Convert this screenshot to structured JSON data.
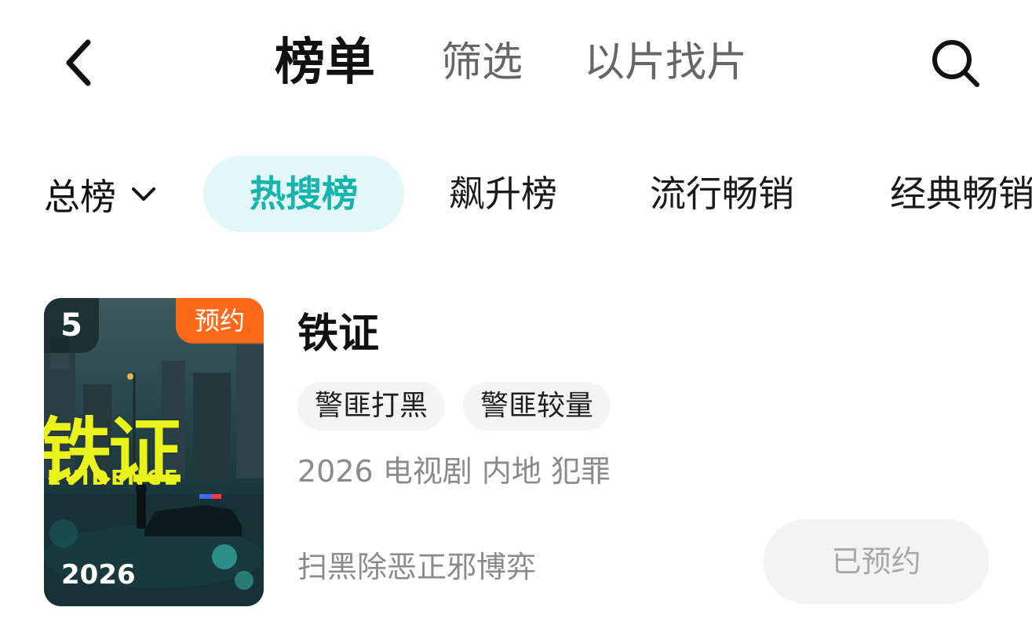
{
  "header": {
    "back_icon": "chevron-left-icon",
    "tabs": [
      {
        "label": "榜单",
        "active": true
      },
      {
        "label": "筛选",
        "active": false
      },
      {
        "label": "以片找片",
        "active": false
      }
    ],
    "search_icon": "search-icon"
  },
  "filter": {
    "dropdown_label": "总榜",
    "dropdown_icon": "chevron-down-icon",
    "chips": [
      {
        "label": "热搜榜",
        "active": true
      },
      {
        "label": "飙升榜",
        "active": false
      },
      {
        "label": "流行畅销",
        "active": false
      },
      {
        "label": "经典畅销",
        "active": false
      }
    ],
    "active_color": "#17b3ad"
  },
  "items": [
    {
      "rank": "5",
      "badge": "预约",
      "badge_color": "#ff6a1a",
      "poster": {
        "year": "2026",
        "title_text": "铁证",
        "subtitle_text": "EVIDENCE"
      },
      "title": "铁证",
      "tags": [
        "警匪打黑",
        "警匪较量"
      ],
      "meta": "2026 电视剧 内地 犯罪",
      "description": "扫黑除恶正邪博弈",
      "action_label": "已预约"
    }
  ]
}
